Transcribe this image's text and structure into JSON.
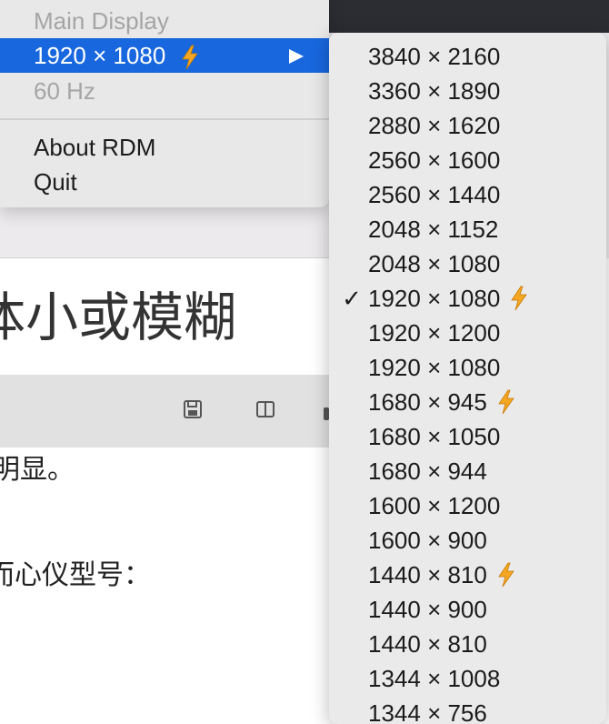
{
  "menu": {
    "header": "Main Display",
    "current_resolution": "1920 × 1080",
    "refresh_rate": "60 Hz",
    "about": "About RDM",
    "quit": "Quit"
  },
  "submenu": {
    "items": [
      {
        "label": "3840 × 2160",
        "checked": false,
        "hidpi": false
      },
      {
        "label": "3360 × 1890",
        "checked": false,
        "hidpi": false
      },
      {
        "label": "2880 × 1620",
        "checked": false,
        "hidpi": false
      },
      {
        "label": "2560 × 1600",
        "checked": false,
        "hidpi": false
      },
      {
        "label": "2560 × 1440",
        "checked": false,
        "hidpi": false
      },
      {
        "label": "2048 × 1152",
        "checked": false,
        "hidpi": false
      },
      {
        "label": "2048 × 1080",
        "checked": false,
        "hidpi": false
      },
      {
        "label": "1920 × 1080",
        "checked": true,
        "hidpi": true
      },
      {
        "label": "1920 × 1200",
        "checked": false,
        "hidpi": false
      },
      {
        "label": "1920 × 1080",
        "checked": false,
        "hidpi": false
      },
      {
        "label": "1680 × 945",
        "checked": false,
        "hidpi": true
      },
      {
        "label": "1680 × 1050",
        "checked": false,
        "hidpi": false
      },
      {
        "label": "1680 × 944",
        "checked": false,
        "hidpi": false
      },
      {
        "label": "1600 × 1200",
        "checked": false,
        "hidpi": false
      },
      {
        "label": "1600 × 900",
        "checked": false,
        "hidpi": false
      },
      {
        "label": "1440 × 810",
        "checked": false,
        "hidpi": true
      },
      {
        "label": "1440 × 900",
        "checked": false,
        "hidpi": false
      },
      {
        "label": "1440 × 810",
        "checked": false,
        "hidpi": false
      },
      {
        "label": "1344 × 1008",
        "checked": false,
        "hidpi": false
      },
      {
        "label": "1344 × 756",
        "checked": false,
        "hidpi": false
      }
    ],
    "checkmark": "✓"
  },
  "document": {
    "heading": "体小或模糊",
    "line1": "明显。",
    "line2": "而心仪型号："
  },
  "icons": {
    "hidpi": "lightning-bolt-icon",
    "submenu_arrow": "triangle-right-icon",
    "save": "floppy-disk-icon",
    "split": "split-view-icon"
  },
  "colors": {
    "highlight": "#1867de",
    "bolt": "#f5a623",
    "menu_bg": "#e9e8e9"
  }
}
